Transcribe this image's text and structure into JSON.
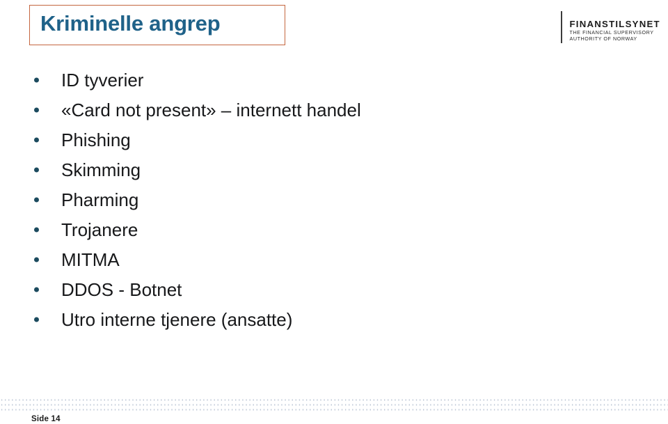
{
  "slide": {
    "title": "Kriminelle angrep",
    "title_color": "#1f6289",
    "title_border_color": "#c4663f",
    "background_color": "#ffffff"
  },
  "logo": {
    "name": "FINANSTILSYNET",
    "subtitle_line1": "THE FINANCIAL SUPERVISORY",
    "subtitle_line2": "AUTHORITY OF NORWAY"
  },
  "bullets": {
    "bullet_color": "#1b4a5e",
    "text_color": "#17181a",
    "items": [
      {
        "label": "ID tyverier"
      },
      {
        "label": "«Card not present» – internett handel"
      },
      {
        "label": "Phishing"
      },
      {
        "label": "Skimming"
      },
      {
        "label": "Pharming"
      },
      {
        "label": "Trojanere"
      },
      {
        "label": "MITMA"
      },
      {
        "label": "DDOS - Botnet"
      },
      {
        "label": "Utro interne tjenere (ansatte)"
      }
    ]
  },
  "footer": {
    "page_label": "Side 14",
    "dot_color": "#b9c4d4"
  }
}
